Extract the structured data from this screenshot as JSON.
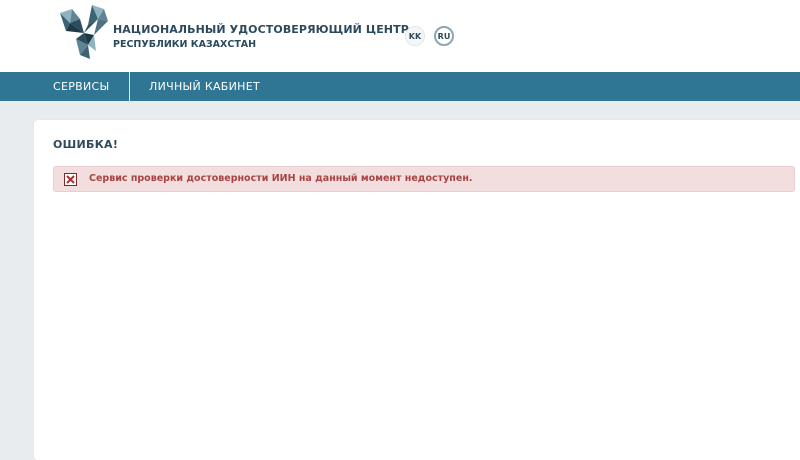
{
  "header": {
    "org_title": "НАЦИОНАЛЬНЫЙ УДОСТОВЕРЯЮЩИЙ ЦЕНТР",
    "org_subtitle": "РЕСПУБЛИКИ КАЗАХСТАН",
    "logo_icon": "nuc-logo-icon",
    "languages": [
      {
        "code": "KK",
        "active": false
      },
      {
        "code": "RU",
        "active": true
      }
    ]
  },
  "nav": {
    "items": [
      {
        "label": "СЕРВИСЫ"
      },
      {
        "label": "ЛИЧНЫЙ КАБИНЕТ"
      }
    ]
  },
  "main": {
    "title": "ОШИБКА!",
    "alert": {
      "icon": "error-close-icon",
      "message": "Сервис проверки достоверности ИИН на данный момент недоступен."
    }
  },
  "colors": {
    "nav_background": "#2e7694",
    "page_background": "#e9ecef",
    "alert_background": "#f2dede",
    "alert_text": "#a94442",
    "heading_text": "#2c4a5c"
  }
}
